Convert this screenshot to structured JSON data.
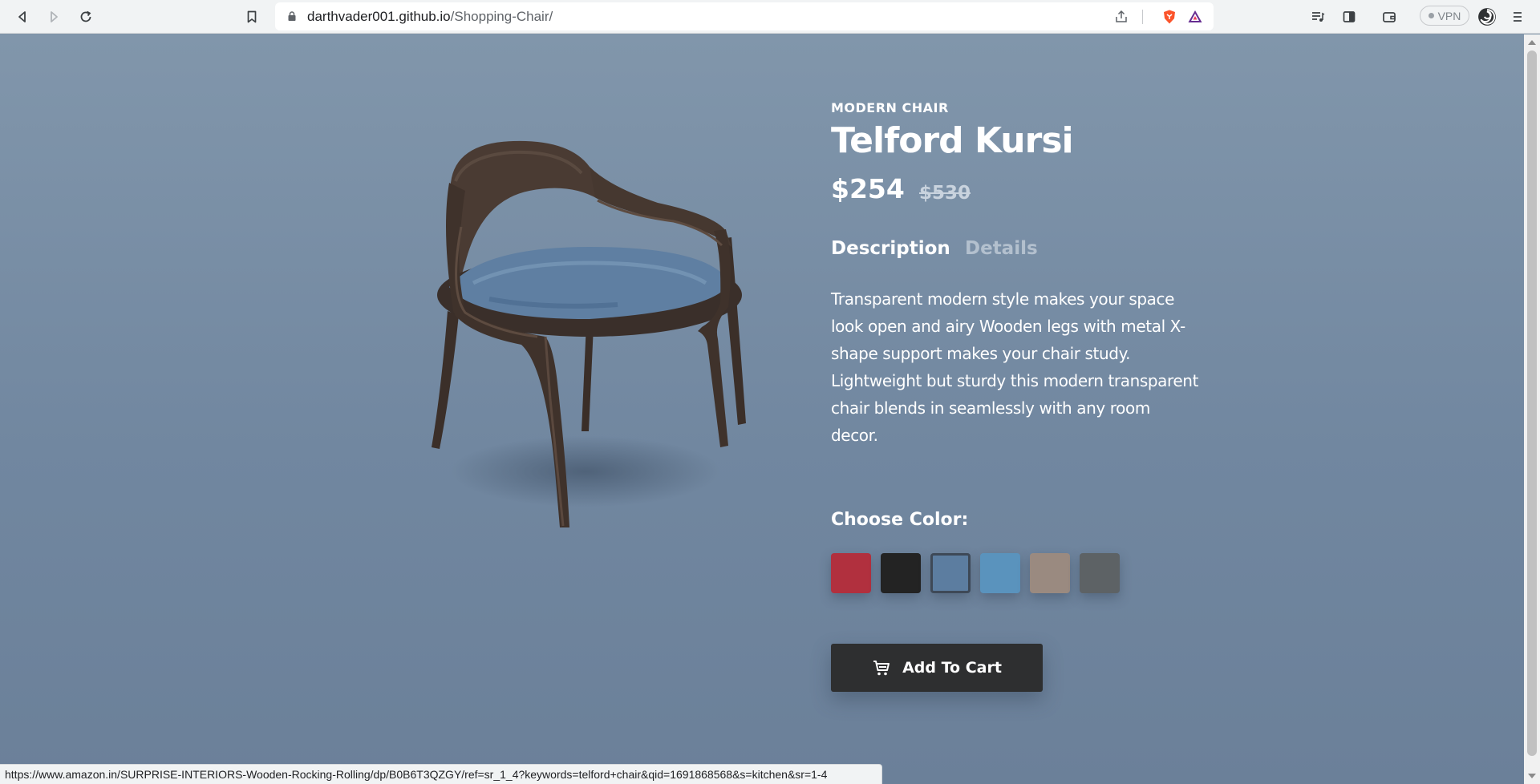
{
  "browser": {
    "url_host": "darthvader001.github.io",
    "url_path": "/Shopping-Chair/",
    "vpn_label": "VPN",
    "status_url": "https://www.amazon.in/SURPRISE-INTERIORS-Wooden-Rocking-Rolling/dp/B0B6T3QZGY/ref=sr_1_4?keywords=telford+chair&qid=1691868568&s=kitchen&sr=1-4",
    "icons": [
      "back-icon",
      "forward-icon",
      "reload-icon",
      "bookmark-icon",
      "lock-icon",
      "share-icon",
      "brave-shield-icon",
      "brave-rewards-icon",
      "playlist-icon",
      "sidebar-icon",
      "wallet-icon",
      "profile-icon",
      "menu-icon"
    ]
  },
  "product": {
    "category": "MODERN CHAIR",
    "name": "Telford Kursi",
    "price": "$254",
    "old_price": "$530",
    "tabs": [
      {
        "label": "Description",
        "active": true
      },
      {
        "label": "Details",
        "active": false
      }
    ],
    "description": "Transparent modern style makes your space look open and airy Wooden legs with metal X-shape support makes your chair study. Lightweight but sturdy this modern transparent chair blends in seamlessly with any room decor.",
    "choose_color_label": "Choose Color:",
    "colors": [
      {
        "name": "red",
        "hex": "#b1303e",
        "selected": false
      },
      {
        "name": "black",
        "hex": "#232323",
        "selected": false
      },
      {
        "name": "blue-velvet",
        "hex": "#5c7da0",
        "selected": true
      },
      {
        "name": "light-blue",
        "hex": "#5a93bd",
        "selected": false
      },
      {
        "name": "beige",
        "hex": "#9a8a80",
        "selected": false
      },
      {
        "name": "grey",
        "hex": "#5d6265",
        "selected": false
      }
    ],
    "add_to_cart_label": "Add To Cart"
  },
  "theme": {
    "background": "#7f94a8",
    "button_bg": "#2e2f30",
    "text": "#ffffff",
    "muted_tab": "#b3c0ce"
  }
}
